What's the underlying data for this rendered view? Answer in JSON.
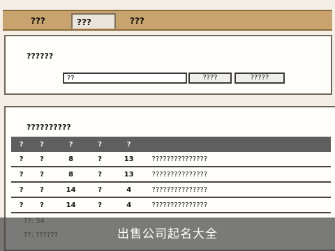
{
  "tabs": [
    "???",
    "???",
    "???"
  ],
  "name_panel": {
    "label": "??????",
    "input_value": "??",
    "buttons": [
      "????",
      "?????"
    ]
  },
  "results_panel": {
    "title": "??????????",
    "columns": [
      "?",
      "?",
      "?",
      "?",
      "?"
    ],
    "rows": [
      {
        "c1": "?",
        "c2": "?",
        "c3": "8",
        "c4": "?",
        "c5": "13",
        "desc": "???????????????"
      },
      {
        "c1": "?",
        "c2": "?",
        "c3": "8",
        "c4": "?",
        "c5": "13",
        "desc": "???????????????"
      },
      {
        "c1": "?",
        "c2": "?",
        "c3": "14",
        "c4": "?",
        "c5": "4",
        "desc": "???????????????"
      },
      {
        "c1": "?",
        "c2": "?",
        "c3": "14",
        "c4": "?",
        "c5": "4",
        "desc": "???????????????"
      }
    ],
    "count_label": "??:",
    "count_value": "34",
    "note_label": "??:",
    "note_text": "??????"
  },
  "caption": "出售公司起名大全"
}
